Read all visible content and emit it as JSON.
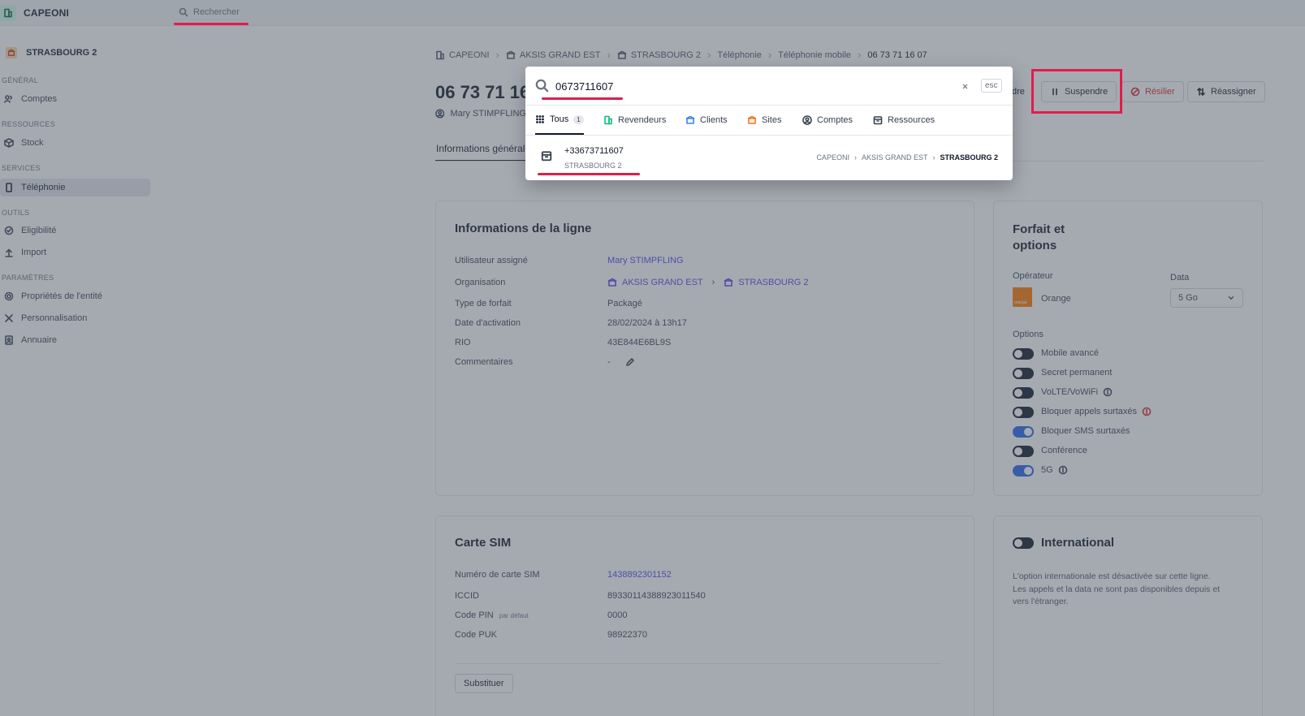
{
  "app": {
    "title": "CAPEONI",
    "search_label": "Rechercher"
  },
  "sidebar": {
    "org": "STRASBOURG 2",
    "sections": {
      "general": "GÉNÉRAL",
      "resources": "RESSOURCES",
      "services": "SERVICES",
      "tools": "OUTILS",
      "settings": "PARAMÈTRES"
    },
    "items": {
      "comptes": "Comptes",
      "stock": "Stock",
      "telephonie": "Téléphonie",
      "eligibilite": "Eligibilité",
      "import": "Import",
      "proprietes": "Propriétés de l'entité",
      "personnalisation": "Personnalisation",
      "annuaire": "Annuaire"
    }
  },
  "breadcrumb": [
    "CAPEONI",
    "AKSIS GRAND EST",
    "STRASBOURG 2",
    "Téléphonie",
    "Téléphonie mobile",
    "06 73 71 16 07"
  ],
  "line": {
    "title": "06 73 71 16 07",
    "user": "Mary STIMPFLING",
    "tab": "Informations générales"
  },
  "actions": {
    "partial": "dre",
    "suspend": "Suspendre",
    "cancel": "Résilier",
    "reassign": "Réassigner"
  },
  "info_card": {
    "title": "Informations de la ligne",
    "rows": {
      "user_label": "Utilisateur assigné",
      "user_value": "Mary STIMPFLING",
      "org_label": "Organisation",
      "org_value_1": "AKSIS GRAND EST",
      "org_value_2": "STRASBOURG 2",
      "plan_label": "Type de forfait",
      "plan_value": "Packagé",
      "activation_label": "Date d'activation",
      "activation_value": "28/02/2024 à 13h17",
      "rio_label": "RIO",
      "rio_value": "43E844E6BL9S",
      "comments_label": "Commentaires",
      "comments_value": "-"
    }
  },
  "sim_card": {
    "title": "Carte SIM",
    "rows": {
      "num_label": "Numéro de carte SIM",
      "num_value": "1438892301152",
      "iccid_label": "ICCID",
      "iccid_value": "89330114388923011540",
      "pin_label": "Code PIN",
      "pin_hint": "par défaut",
      "pin_value": "0000",
      "puk_label": "Code PUK",
      "puk_value": "98922370"
    },
    "substitute": "Substituer"
  },
  "plan_card": {
    "title_1": "Forfait et",
    "title_2": "options",
    "operator_label": "Opérateur",
    "operator": "Orange",
    "operator_logo_text": "orange",
    "data_label": "Data",
    "data_value": "5 Go",
    "options_label": "Options",
    "options": {
      "mobile": "Mobile avancé",
      "secret": "Secret permanent",
      "volte": "VoLTE/VoWiFi",
      "block_calls": "Bloquer appels surtaxés",
      "block_sms": "Bloquer SMS surtaxés",
      "conference": "Conférence",
      "fiveg": "5G"
    },
    "option_states": {
      "mobile": false,
      "secret": false,
      "volte": false,
      "block_calls": false,
      "block_sms": true,
      "conference": false,
      "fiveg": true
    }
  },
  "intl_card": {
    "title": "International",
    "text_1": "L'option internationale est désactivée sur cette ligne.",
    "text_2": "Les appels et la data ne sont pas disponibles depuis et",
    "text_3": "vers l'étranger."
  },
  "search_modal": {
    "query": "0673711607",
    "esc": "esc",
    "tabs": {
      "all": "Tous",
      "all_count": "1",
      "resellers": "Revendeurs",
      "clients": "Clients",
      "sites": "Sites",
      "accounts": "Comptes",
      "resources": "Ressources"
    },
    "result": {
      "number": "+33673711607",
      "org": "STRASBOURG 2",
      "path_1": "CAPEONI",
      "path_2": "AKSIS GRAND EST",
      "path_3": "STRASBOURG 2"
    }
  },
  "colors": {
    "accent": "#4f46e5",
    "annotation": "#e11d48",
    "toggle_on": "#2563eb",
    "orange_brand": "#ff7900"
  }
}
